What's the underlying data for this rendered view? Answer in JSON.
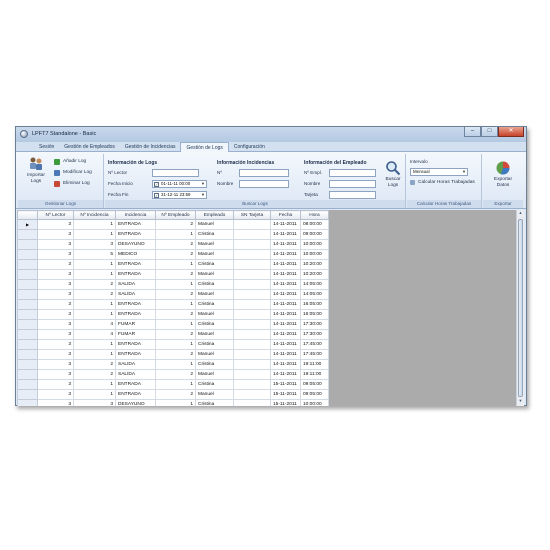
{
  "window": {
    "title": "LPFT7 Standalone - Basic",
    "minimize": "–",
    "maximize": "□",
    "close": "✕"
  },
  "tabs": [
    "Sesión",
    "Gestión de Empleados",
    "Gestión de Incidencias",
    "Gestión de Logs",
    "Configuración"
  ],
  "ribbon": {
    "gestionar": {
      "import_label_1": "Importar",
      "import_label_2": "Logs",
      "add": "Añadir Log",
      "modify": "Modificar Log",
      "delete": "Eliminar Log",
      "group_label": "Gestionar Logs"
    },
    "buscar": {
      "logs_title": "Información de Logs",
      "lector_label": "Nº Lector",
      "fecha_inicio_label": "Fecha Inicio",
      "fecha_inicio_value": "01-11-11 00:00",
      "fecha_fin_label": "Fecha Fin",
      "fecha_fin_value": "31-12-11 23:59",
      "incid_title": "Información Incidencias",
      "incid_num_label": "Nº",
      "incid_nombre_label": "Nombre",
      "emp_title": "Información del Empleado",
      "emp_num_label": "Nº Empl.",
      "emp_nombre_label": "Nombre",
      "emp_tarjeta_label": "Tarjeta",
      "search_label_1": "Buscar",
      "search_label_2": "Logs",
      "group_label": "Buscar Logs"
    },
    "calcular": {
      "intervalo_label": "Intervalo",
      "intervalo_value": "Mensual",
      "calc_label": "Calcular Horas Trabajadas",
      "group_label": "Calcular Horas Trabajadas"
    },
    "exportar": {
      "export_label_1": "Exportar",
      "export_label_2": "Datos",
      "group_label": "Exportar"
    }
  },
  "colors": {
    "accent": "#dfe9f5",
    "ribbon_label": "#3e5b80",
    "selected_row": "#e6edf6"
  },
  "table": {
    "columns": [
      "Nº Lector",
      "Nº Incidencia",
      "Incidencia",
      "Nº Empleado",
      "Empleado",
      "SN Tarjeta",
      "Fecha",
      "Hora"
    ],
    "current_row_marker": "▶",
    "rows": [
      [
        "3",
        "1",
        "ENTRADA",
        "2",
        "Manuel",
        "",
        "14-11-2011",
        "08:00:00"
      ],
      [
        "3",
        "1",
        "ENTRADA",
        "1",
        "Cristina",
        "",
        "14-11-2011",
        "09:00:00"
      ],
      [
        "3",
        "3",
        "DESAYUNO",
        "2",
        "Manuel",
        "",
        "14-11-2011",
        "10:00:00"
      ],
      [
        "3",
        "5",
        "MEDICO",
        "2",
        "Manuel",
        "",
        "14-11-2011",
        "10:00:00"
      ],
      [
        "3",
        "1",
        "ENTRADA",
        "1",
        "Cristina",
        "",
        "14-11-2011",
        "10:20:00"
      ],
      [
        "3",
        "1",
        "ENTRADA",
        "2",
        "Manuel",
        "",
        "14-11-2011",
        "10:20:00"
      ],
      [
        "3",
        "2",
        "SALIDA",
        "1",
        "Cristina",
        "",
        "14-11-2011",
        "14:05:00"
      ],
      [
        "3",
        "2",
        "SALIDA",
        "2",
        "Manuel",
        "",
        "14-11-2011",
        "14:05:00"
      ],
      [
        "3",
        "1",
        "ENTRADA",
        "1",
        "Cristina",
        "",
        "14-11-2011",
        "16:05:00"
      ],
      [
        "3",
        "1",
        "ENTRADA",
        "2",
        "Manuel",
        "",
        "14-11-2011",
        "16:05:00"
      ],
      [
        "3",
        "4",
        "FUMAR",
        "1",
        "Cristina",
        "",
        "14-11-2011",
        "17:30:00"
      ],
      [
        "3",
        "4",
        "FUMAR",
        "2",
        "Manuel",
        "",
        "14-11-2011",
        "17:30:00"
      ],
      [
        "3",
        "1",
        "ENTRADA",
        "1",
        "Cristina",
        "",
        "14-11-2011",
        "17:45:00"
      ],
      [
        "3",
        "1",
        "ENTRADA",
        "2",
        "Manuel",
        "",
        "14-11-2011",
        "17:45:00"
      ],
      [
        "3",
        "2",
        "SALIDA",
        "1",
        "Cristina",
        "",
        "14-11-2011",
        "19:11:00"
      ],
      [
        "3",
        "2",
        "SALIDA",
        "2",
        "Manuel",
        "",
        "14-11-2011",
        "19:11:00"
      ],
      [
        "3",
        "1",
        "ENTRADA",
        "1",
        "Cristina",
        "",
        "15-11-2011",
        "09:05:00"
      ],
      [
        "3",
        "1",
        "ENTRADA",
        "2",
        "Manuel",
        "",
        "15-11-2011",
        "09:05:00"
      ],
      [
        "3",
        "3",
        "DESAYUNO",
        "1",
        "Cristina",
        "",
        "15-11-2011",
        "10:00:00"
      ]
    ]
  }
}
